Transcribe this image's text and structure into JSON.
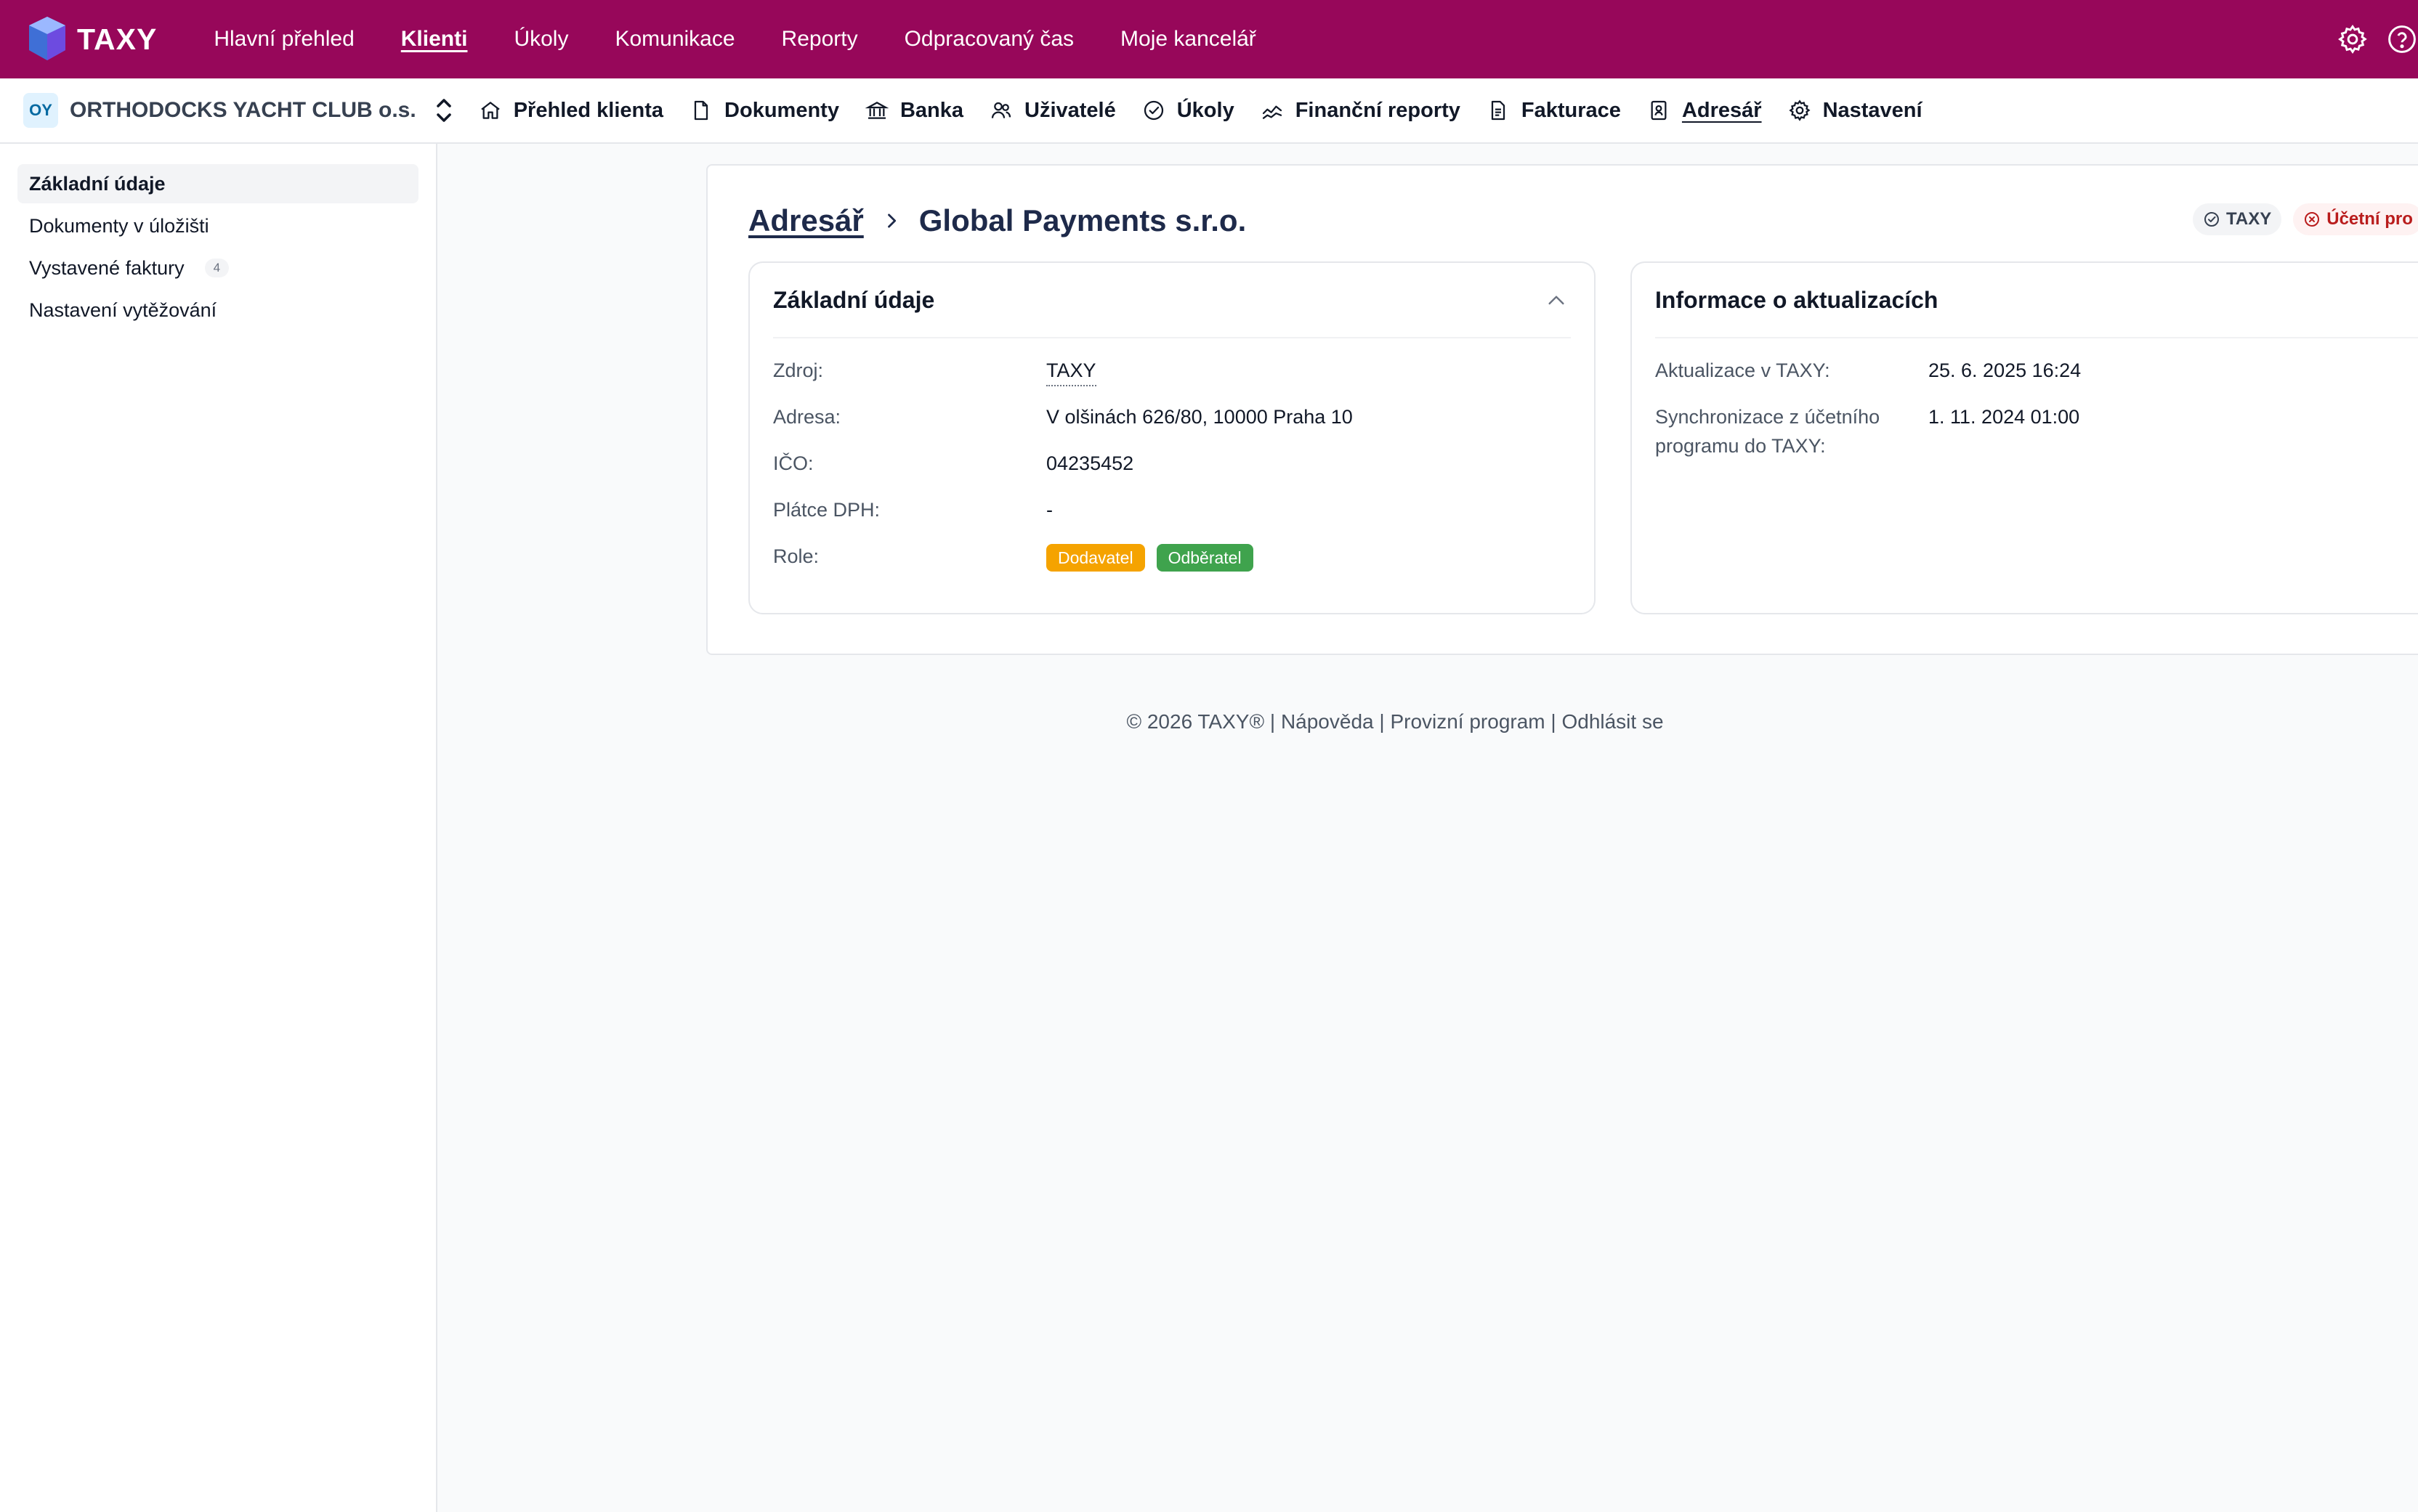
{
  "brand": {
    "name": "TAXY"
  },
  "main_nav": [
    {
      "label": "Hlavní přehled",
      "active": false
    },
    {
      "label": "Klienti",
      "active": true
    },
    {
      "label": "Úkoly",
      "active": false
    },
    {
      "label": "Komunikace",
      "active": false
    },
    {
      "label": "Reporty",
      "active": false
    },
    {
      "label": "Odpracovaný čas",
      "active": false
    },
    {
      "label": "Moje kancelář",
      "active": false
    }
  ],
  "client": {
    "initials": "OY",
    "name": "ORTHODOCKS YACHT CLUB o.s."
  },
  "sub_nav": [
    {
      "label": "Přehled klienta",
      "icon": "home-icon"
    },
    {
      "label": "Dokumenty",
      "icon": "document-icon"
    },
    {
      "label": "Banka",
      "icon": "bank-icon"
    },
    {
      "label": "Uživatelé",
      "icon": "users-icon"
    },
    {
      "label": "Úkoly",
      "icon": "check-circle-icon"
    },
    {
      "label": "Finanční reporty",
      "icon": "chart-line-icon"
    },
    {
      "label": "Fakturace",
      "icon": "invoice-icon"
    },
    {
      "label": "Adresář",
      "icon": "contact-book-icon",
      "active": true
    },
    {
      "label": "Nastavení",
      "icon": "gear-icon"
    }
  ],
  "sidebar": {
    "items": [
      {
        "label": "Základní údaje",
        "active": true
      },
      {
        "label": "Dokumenty v úložišti"
      },
      {
        "label": "Vystavené faktury",
        "count": "4"
      },
      {
        "label": "Nastavení vytěžování"
      }
    ]
  },
  "breadcrumb": {
    "parent": "Adresář",
    "current": "Global Payments s.r.o."
  },
  "status_badges": {
    "taxy": "TAXY",
    "accounting": "Účetní pro"
  },
  "basic_info": {
    "title": "Základní údaje",
    "source_label": "Zdroj:",
    "source_value": "TAXY",
    "address_label": "Adresa:",
    "address_value": "V olšinách 626/80, 10000 Praha 10",
    "ico_label": "IČO:",
    "ico_value": "04235452",
    "vat_label": "Plátce DPH:",
    "vat_value": "-",
    "role_label": "Role:",
    "roles": [
      "Dodavatel",
      "Odběratel"
    ]
  },
  "update_info": {
    "title": "Informace o aktualizacích",
    "taxy_label": "Aktualizace v TAXY:",
    "taxy_value": "25. 6. 2025 16:24",
    "sync_label": "Synchronizace z účetního programu do TAXY:",
    "sync_value": "1. 11. 2024 01:00"
  },
  "footer": {
    "copyright": "© 2026 TAXY®",
    "help": "Nápověda",
    "commission": "Provizní program",
    "logout": "Odhlásit se",
    "separator": " | "
  },
  "colors": {
    "topbar": "#97075a",
    "supplier": "#f5a300",
    "customer": "#3fa34d"
  }
}
